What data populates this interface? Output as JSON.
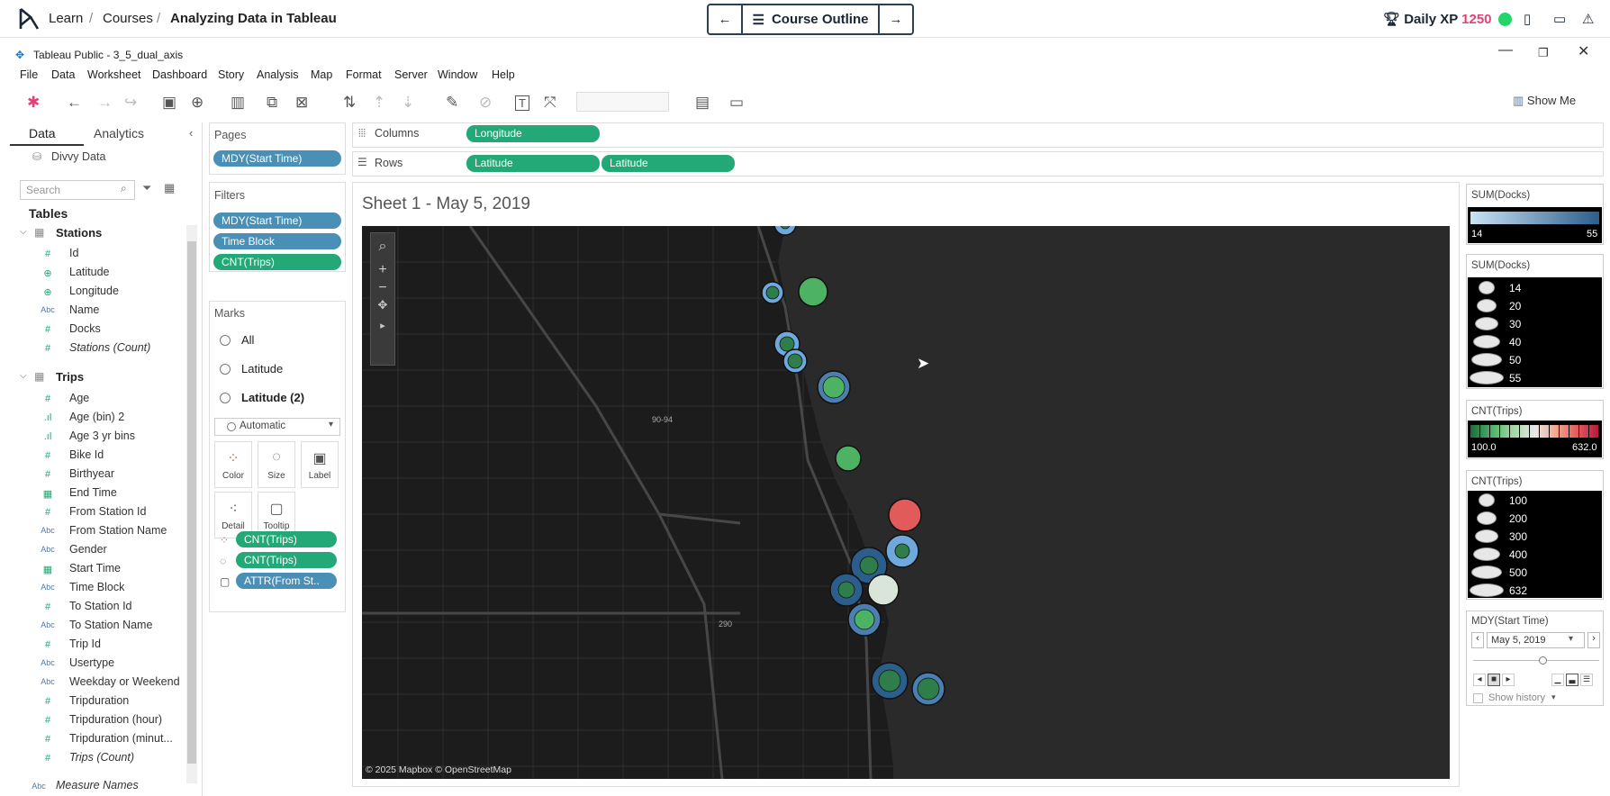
{
  "course_bar": {
    "crumbs": [
      "Learn",
      "Courses",
      "Analyzing Data in Tableau"
    ],
    "outline_label": "Course Outline",
    "xp_label": "Daily XP",
    "xp_value": "1250"
  },
  "window": {
    "title": "Tableau Public - 3_5_dual_axis"
  },
  "menu": [
    "File",
    "Data",
    "Worksheet",
    "Dashboard",
    "Story",
    "Analysis",
    "Map",
    "Format",
    "Server",
    "Window",
    "Help"
  ],
  "toolbar": {
    "show_me": "Show Me"
  },
  "data_pane": {
    "tabs": [
      "Data",
      "Analytics"
    ],
    "datasource": "Divvy Data",
    "search_placeholder": "Search",
    "tables_heading": "Tables",
    "stations": {
      "name": "Stations",
      "fields": [
        {
          "type": "#",
          "label": "Id"
        },
        {
          "type": "geo",
          "label": "Latitude"
        },
        {
          "type": "geo",
          "label": "Longitude"
        },
        {
          "type": "Abc",
          "label": "Name"
        },
        {
          "type": "#",
          "label": "Docks"
        },
        {
          "type": "#",
          "label": "Stations (Count)"
        }
      ]
    },
    "trips": {
      "name": "Trips",
      "fields": [
        {
          "type": "#",
          "label": "Age"
        },
        {
          "type": "bin",
          "label": "Age (bin) 2"
        },
        {
          "type": "bin",
          "label": "Age 3 yr bins"
        },
        {
          "type": "#",
          "label": "Bike Id"
        },
        {
          "type": "#",
          "label": "Birthyear"
        },
        {
          "type": "date",
          "label": "End Time"
        },
        {
          "type": "#",
          "label": "From Station Id"
        },
        {
          "type": "Abc",
          "label": "From Station Name"
        },
        {
          "type": "Abc",
          "label": "Gender"
        },
        {
          "type": "date",
          "label": "Start Time"
        },
        {
          "type": "Abc",
          "label": "Time Block"
        },
        {
          "type": "#",
          "label": "To Station Id"
        },
        {
          "type": "Abc",
          "label": "To Station Name"
        },
        {
          "type": "#",
          "label": "Trip Id"
        },
        {
          "type": "Abc",
          "label": "Usertype"
        },
        {
          "type": "Abc",
          "label": "Weekday or Weekend"
        },
        {
          "type": "#",
          "label": "Tripduration"
        },
        {
          "type": "#",
          "label": "Tripduration (hour)"
        },
        {
          "type": "#",
          "label": "Tripduration (minut..."
        },
        {
          "type": "#",
          "label": "Trips (Count)"
        }
      ]
    },
    "measure_names": "Measure Names"
  },
  "pages": {
    "heading": "Pages",
    "pill": "MDY(Start Time)"
  },
  "filters": {
    "heading": "Filters",
    "pills": [
      "MDY(Start Time)",
      "Time Block",
      "CNT(Trips)"
    ]
  },
  "marks": {
    "heading": "Marks",
    "options": [
      "All",
      "Latitude",
      "Latitude (2)"
    ],
    "type": "Automatic",
    "buttons": [
      "Color",
      "Size",
      "Label",
      "Detail",
      "Tooltip"
    ],
    "pills": [
      "CNT(Trips)",
      "CNT(Trips)",
      "ATTR(From St.."
    ]
  },
  "shelves": {
    "columns_label": "Columns",
    "rows_label": "Rows",
    "columns": [
      "Longitude"
    ],
    "rows": [
      "Latitude",
      "Latitude"
    ]
  },
  "view": {
    "title": "Sheet 1 - May 5, 2019",
    "attribution": "© 2025 Mapbox © OpenStreetMap",
    "road_labels": [
      "90-94",
      "290"
    ]
  },
  "legends": {
    "docks_color": {
      "title": "SUM(Docks)",
      "min": "14",
      "max": "55"
    },
    "docks_size": {
      "title": "SUM(Docks)",
      "values": [
        "14",
        "20",
        "30",
        "40",
        "50",
        "55"
      ]
    },
    "trips_color": {
      "title": "CNT(Trips)",
      "min": "100.0",
      "max": "632.0"
    },
    "trips_size": {
      "title": "CNT(Trips)",
      "values": [
        "100",
        "200",
        "300",
        "400",
        "500",
        "632"
      ]
    },
    "page_control": {
      "title": "MDY(Start Time)",
      "value": "May 5, 2019",
      "history_label": "Show history"
    }
  }
}
